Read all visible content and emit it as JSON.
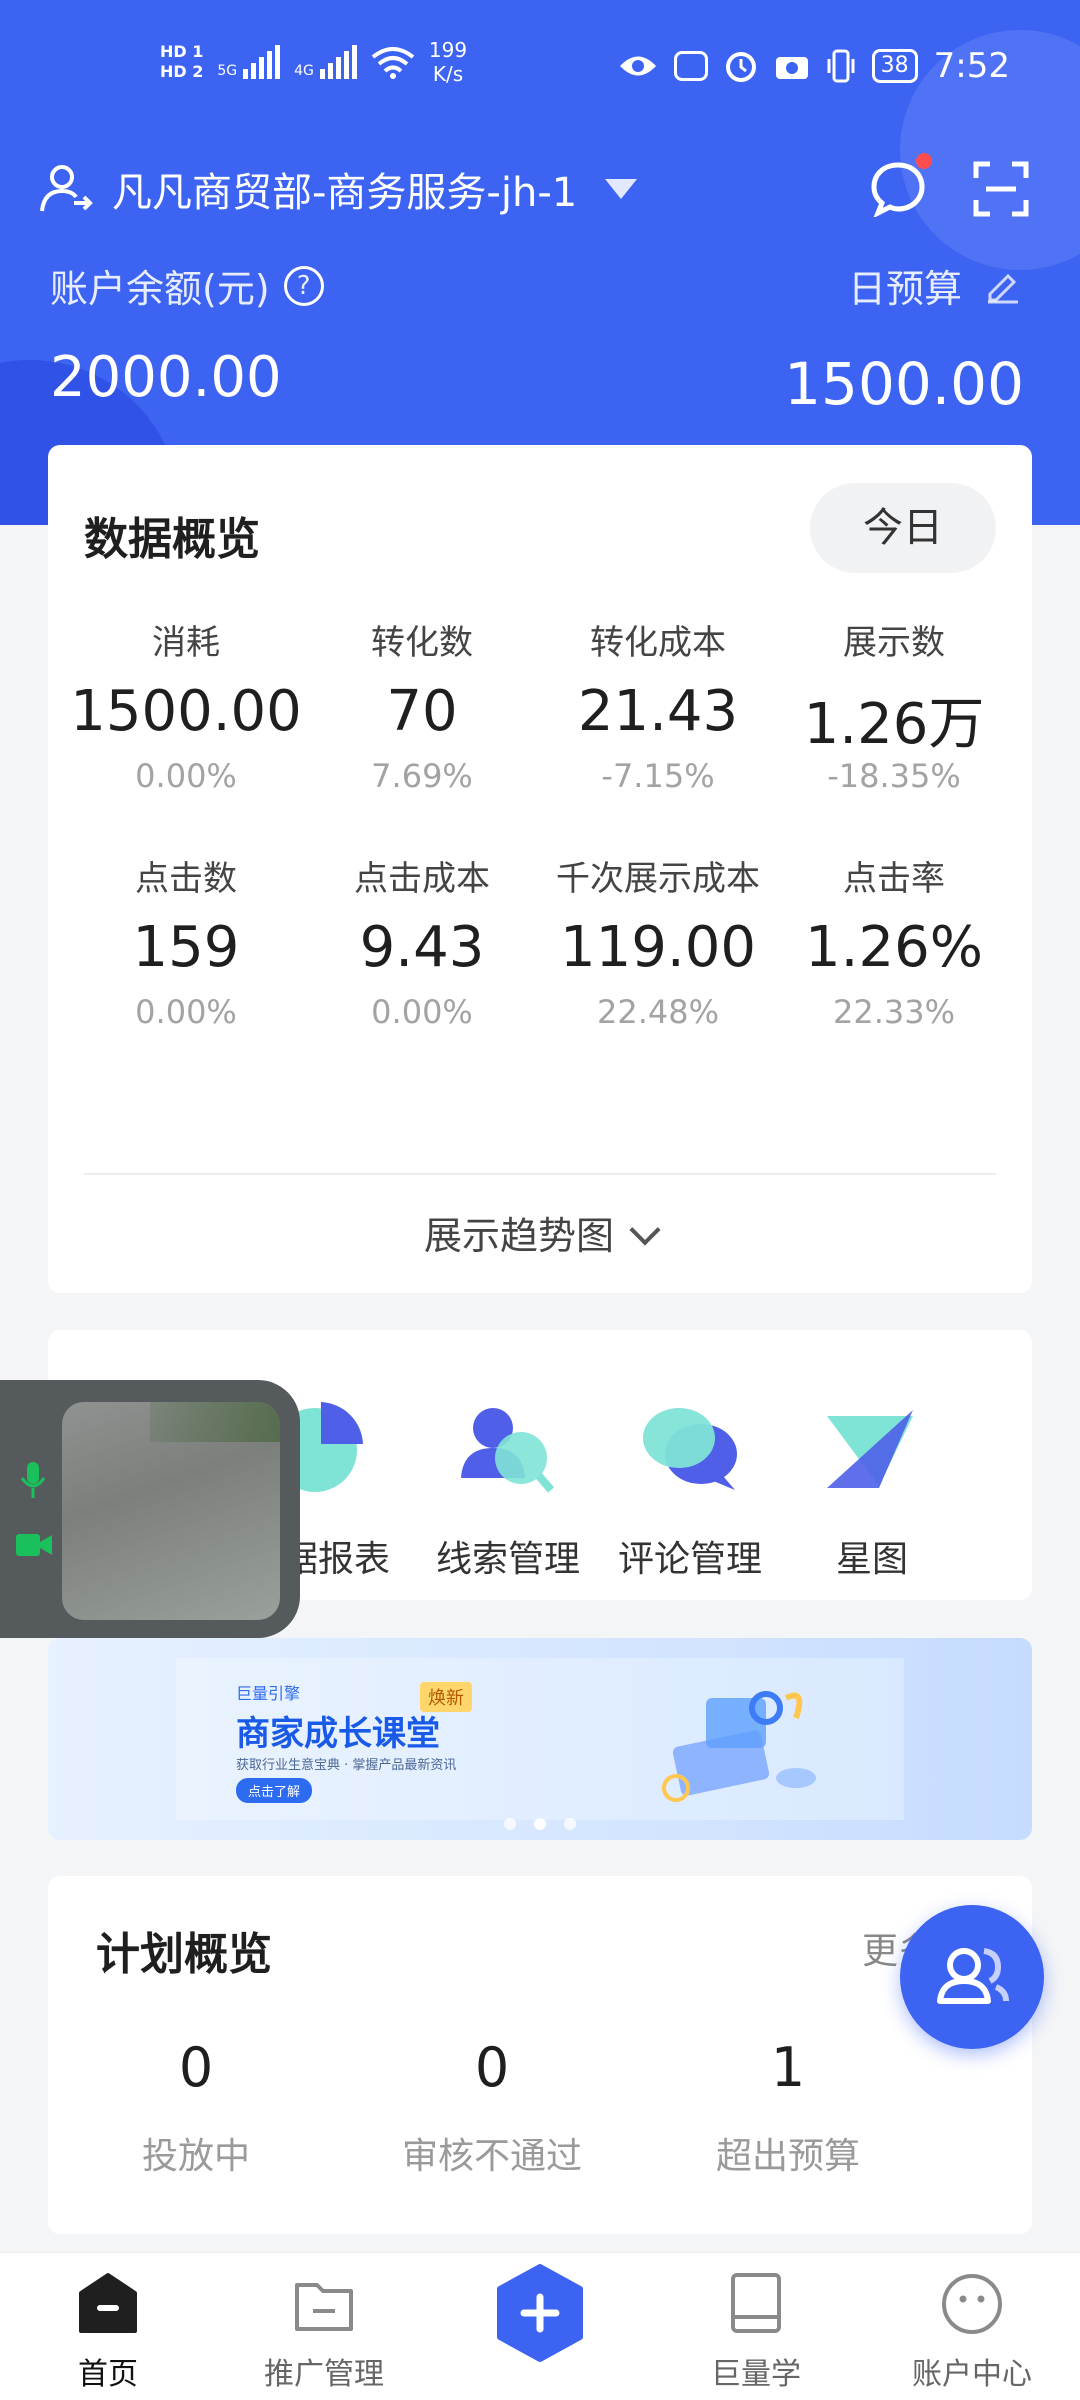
{
  "status_bar": {
    "sim1": "HD 1",
    "sim2": "HD 2",
    "net1": "5G",
    "net2": "4G",
    "speed_value": "199",
    "speed_unit": "K/s",
    "battery": "38",
    "time": "7:52"
  },
  "header": {
    "account_name": "凡凡商贸部-商务服务-jh-1",
    "balance_label": "账户余额(元)",
    "balance_value": "2000.00",
    "budget_label": "日预算",
    "budget_value": "1500.00",
    "help_glyph": "?"
  },
  "overview": {
    "title": "数据概览",
    "period": "今日",
    "metrics": [
      {
        "label": "消耗",
        "value": "1500.00",
        "change": "0.00%"
      },
      {
        "label": "转化数",
        "value": "70",
        "change": "7.69%"
      },
      {
        "label": "转化成本",
        "value": "21.43",
        "change": "-7.15%"
      },
      {
        "label": "展示数",
        "value": "1.26万",
        "change": "-18.35%"
      },
      {
        "label": "点击数",
        "value": "159",
        "change": "0.00%"
      },
      {
        "label": "点击成本",
        "value": "9.43",
        "change": "0.00%"
      },
      {
        "label": "千次展示成本",
        "value": "119.00",
        "change": "22.48%"
      },
      {
        "label": "点击率",
        "value": "1.26%",
        "change": "22.33%"
      }
    ],
    "trend_toggle": "展示趋势图"
  },
  "tools": [
    {
      "label": "数据报表",
      "icon": "pie-chart-icon"
    },
    {
      "label": "线索管理",
      "icon": "leads-icon"
    },
    {
      "label": "评论管理",
      "icon": "comments-icon"
    },
    {
      "label": "星图",
      "icon": "star-map-icon"
    }
  ],
  "banner": {
    "brand": "巨量引擎",
    "title": "商家成长课堂",
    "tag": "焕新",
    "subtitle": "获取行业生意宝典 · 掌握产品最新资讯",
    "cta": "点击了解",
    "active_slide": 2,
    "slide_count": 3
  },
  "plan": {
    "title": "计划概览",
    "more": "更多",
    "stats": [
      {
        "value": "0",
        "label": "投放中"
      },
      {
        "value": "0",
        "label": "审核不通过"
      },
      {
        "value": "1",
        "label": "超出预算"
      }
    ]
  },
  "tabbar": {
    "items": [
      {
        "label": "首页",
        "icon": "home-icon"
      },
      {
        "label": "推广管理",
        "icon": "folder-icon"
      },
      {
        "label": "",
        "icon": "add-icon"
      },
      {
        "label": "巨量学",
        "icon": "book-icon"
      },
      {
        "label": "账户中心",
        "icon": "smiley-icon"
      }
    ]
  },
  "colors": {
    "brand_blue": "#3d63f3",
    "notify_red": "#ff4d4f",
    "muted_text": "#a3a3a3"
  }
}
